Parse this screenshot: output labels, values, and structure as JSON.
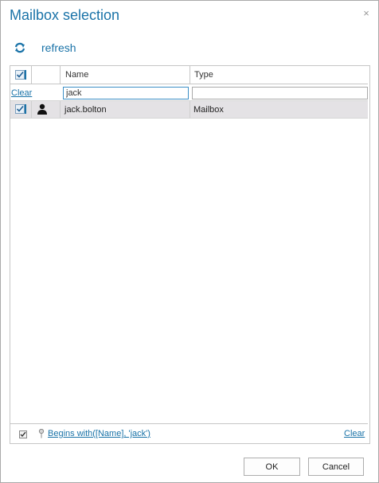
{
  "dialog": {
    "title": "Mailbox selection",
    "close_glyph": "×"
  },
  "toolbar": {
    "refresh_label": "refresh",
    "refresh_icon": "refresh-icon"
  },
  "grid": {
    "columns": [
      "Name",
      "Type"
    ],
    "filter": {
      "clear_label": "Clear",
      "name_value": "jack",
      "type_value": ""
    },
    "rows": [
      {
        "checked": true,
        "icon": "user-icon",
        "name": "jack.bolton",
        "type": "Mailbox"
      }
    ],
    "footer": {
      "filter_expression": "Begins with([Name], 'jack')",
      "clear_label": "Clear"
    }
  },
  "buttons": {
    "ok_label": "OK",
    "cancel_label": "Cancel"
  },
  "colors": {
    "accent": "#1a73a8",
    "selected_row": "#e4e2e5"
  }
}
